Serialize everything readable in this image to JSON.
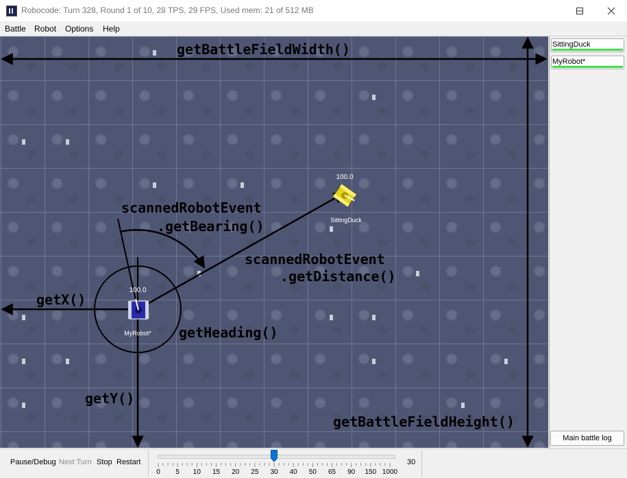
{
  "window": {
    "title": "Robocode: Turn 328, Round 1 of 10, 28 TPS, 29 FPS, Used mem: 21 of 512 MB"
  },
  "menu": [
    "Battle",
    "Robot",
    "Options",
    "Help"
  ],
  "battlefield": {
    "annotations": {
      "width_label": "getBattleFieldWidth()",
      "height_label": "getBattleFieldHeight()",
      "bearing_label_1": "scannedRobotEvent",
      "bearing_label_2": ".getBearing()",
      "distance_label_1": "scannedRobotEvent",
      "distance_label_2": ".getDistance()",
      "x_label": "getX()",
      "y_label": "getY()",
      "heading_label": "getHeading()"
    },
    "robots": [
      {
        "name": "SittingDuck",
        "energy": "100.0",
        "color": "#e6d31a"
      },
      {
        "name": "MyRobot*",
        "energy": "100.0",
        "color": "#2a2aa8"
      }
    ]
  },
  "robot_list": [
    {
      "name": "SittingDuck",
      "health_color": "#42dc4c"
    },
    {
      "name": "MyRobot*",
      "health_color": "#42dc4c"
    }
  ],
  "log_button": "Main battle log",
  "controls": {
    "pause": "Pause/Debug",
    "next_turn": "Next Turn",
    "stop": "Stop",
    "restart": "Restart"
  },
  "speed": {
    "ticks": [
      "0",
      "5",
      "10",
      "15",
      "20",
      "25",
      "30",
      "40",
      "50",
      "65",
      "90",
      "150",
      "1000"
    ],
    "selected": "30",
    "value_label": "30"
  }
}
